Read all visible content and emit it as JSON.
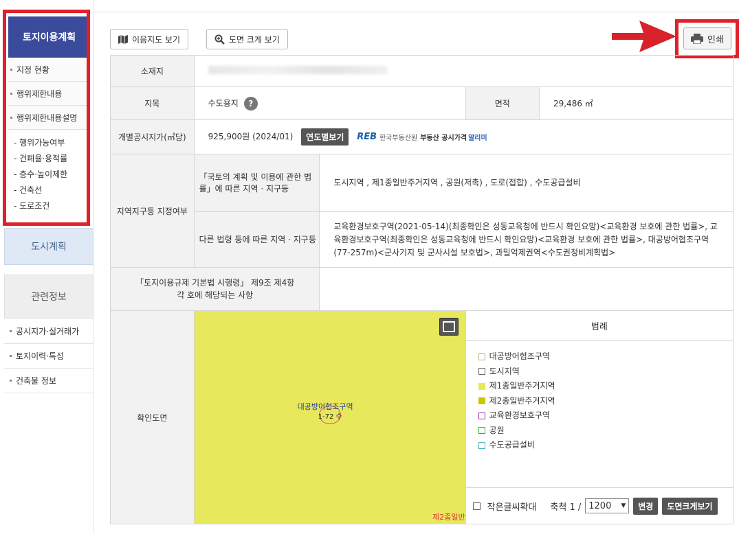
{
  "sidebar": {
    "title": "토지이용계획",
    "items": [
      "지정 현황",
      "행위제한내용",
      "행위제한내용설명"
    ],
    "sub_items": [
      "- 행위가능여부",
      "- 건폐율·용적률",
      "- 층수·높이제한",
      "- 건축선",
      "- 도로조건"
    ],
    "city_plan": "도시계획",
    "related_info": "관련정보",
    "related_items": [
      "공시지가·실거래가",
      "토지이력·특성",
      "건축물 정보"
    ]
  },
  "toolbar": {
    "map_btn": "이음지도 보기",
    "zoom_btn": "도면 크게 보기",
    "print_btn": "인쇄"
  },
  "table": {
    "location_label": "소재지",
    "jimok_label": "지목",
    "jimok_value": "수도용지",
    "help_icon": "?",
    "area_label": "면적",
    "area_value": "29,486 ㎡",
    "price_label": "개별공시지가(㎡당)",
    "price_value": "925,900원 (2024/01)",
    "year_btn": "연도별보기",
    "reb_logo": "REB",
    "reb_org": "한국부동산원",
    "reb_service": "부동산 공시가격",
    "reb_service2": "알리미",
    "zone_label": "지역지구등 지정여부",
    "zone_sub1": "「국토의 계획 및 이용에 관한 법률」에 따른 지역 · 지구등",
    "zone_val1": "도시지역 , 제1종일반주거지역 , 공원(저촉) , 도로(접합) , 수도공급설비",
    "zone_sub2": "다른 법령 등에 따른 지역 · 지구등",
    "zone_val2": "교육환경보호구역(2021-05-14)(최종확인은 성동교육청에 반드시 확인요망)<교육환경 보호에 관한 법률>, 교육환경보호구역(최종확인은 성동교육청에 반드시 확인요망)<교육환경 보호에 관한 법률>, 대공방어협조구역(77-257m)<군사기지 및 군사시설 보호법>, 과밀억제권역<수도권정비계획법>",
    "rule_label": "「토지이용규제 기본법 시행령」 제9조 제4항 각 호에 해당되는 사항",
    "rule_value": "",
    "map_label": "확인도면"
  },
  "map": {
    "zone_label": "대공방어협조구역",
    "zone_sub": "1-72 수",
    "corner_label": "제2종일반"
  },
  "legend": {
    "title": "범례",
    "items": [
      {
        "label": "대공방어협조구역",
        "color": "#c8a878",
        "fill": "#ffffff"
      },
      {
        "label": "도시지역",
        "color": "#666666",
        "fill": "#ffffff"
      },
      {
        "label": "제1종일반주거지역",
        "color": "#e8e85d",
        "fill": "#e8e85d"
      },
      {
        "label": "제2종일반주거지역",
        "color": "#c8c800",
        "fill": "#c8c800"
      },
      {
        "label": "교육환경보호구역",
        "color": "#9a2aa8",
        "fill": "#ffffff"
      },
      {
        "label": "공원",
        "color": "#2ab42a",
        "fill": "#ffffff"
      },
      {
        "label": "수도공급설비",
        "color": "#4ab0c0",
        "fill": "#ffffff"
      }
    ],
    "small_font_label": "작은글씨확대",
    "scale_label": "축척 1 /",
    "scale_value": "1200",
    "change_btn": "변경",
    "big_map_btn": "도면크게보기"
  }
}
